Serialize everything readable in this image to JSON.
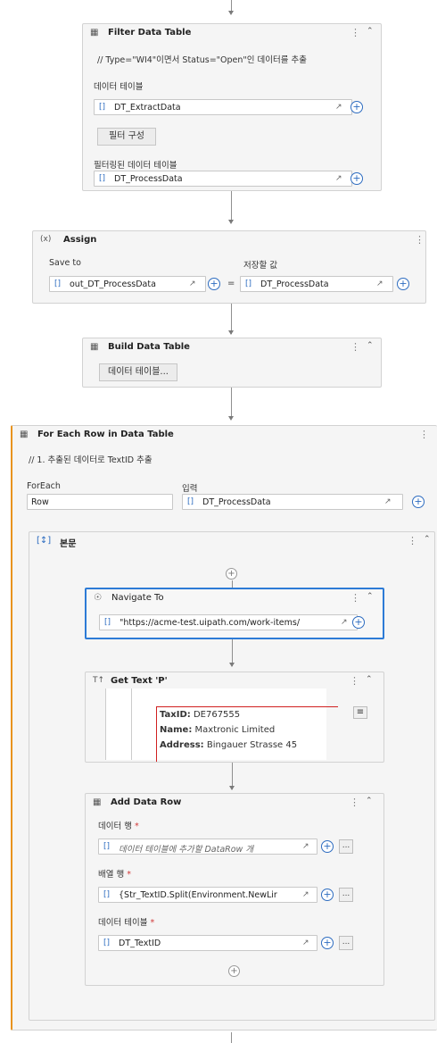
{
  "filter": {
    "title": "Filter Data Table",
    "comment": "// Type=\"WI4\"이면서 Status=\"Open\"인 데이터를 추출",
    "input_label": "데이터 테이블",
    "input_value": "DT_ExtractData",
    "config_button": "필터 구성",
    "output_label": "필터링된 데이터 테이블",
    "output_value": "DT_ProcessData"
  },
  "assign": {
    "title": "Assign",
    "save_to_label": "Save to",
    "value_label": "저장할 값",
    "left_value": "out_DT_ProcessData",
    "right_value": "DT_ProcessData",
    "equals": "="
  },
  "build": {
    "title": "Build Data Table",
    "button": "데이터 테이블..."
  },
  "foreach": {
    "title": "For Each Row in Data Table",
    "comment": "// 1. 추출된 데이터로 TextID 추출",
    "foreach_label": "ForEach",
    "foreach_value": "Row",
    "input_label": "입력",
    "input_value": "DT_ProcessData"
  },
  "body": {
    "title": "본문"
  },
  "navigate": {
    "title": "Navigate To",
    "url": "\"https://acme-test.uipath.com/work-items/"
  },
  "gettext": {
    "title": "Get Text 'P'",
    "lines": [
      {
        "key": "TaxID:",
        "val": "DE767555"
      },
      {
        "key": "Name:",
        "val": "Maxtronic Limited"
      },
      {
        "key": "Address:",
        "val": "Bingauer Strasse 45"
      }
    ]
  },
  "adddatarow": {
    "title": "Add Data Row",
    "datarow_label": "데이터 행",
    "datarow_placeholder": "데이터 테이블에 추가할 DataRow 개",
    "array_label": "배열 행",
    "array_value": "{Str_TextID.Split(Environment.NewLir",
    "table_label": "데이터 테이블",
    "table_value": "DT_TextID",
    "required_mark": "*"
  },
  "icons": {
    "expression": "[]",
    "kebab": "⋮",
    "collapse": "≈",
    "plus": "+",
    "more": "...",
    "expand": "↗"
  }
}
